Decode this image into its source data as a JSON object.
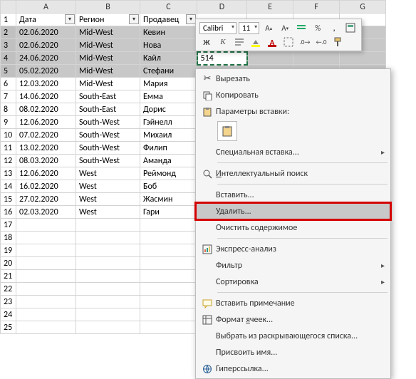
{
  "columns": [
    "A",
    "B",
    "C",
    "D",
    "E",
    "F",
    "G"
  ],
  "headers": {
    "A": "Дата",
    "B": "Регион",
    "C": "Продавец"
  },
  "rows": [
    {
      "n": 1,
      "header": true
    },
    {
      "n": 2,
      "sel": true,
      "A": "02.06.2020",
      "B": "Mid-West",
      "C": "Кевин"
    },
    {
      "n": 3,
      "sel": true,
      "A": "02.06.2020",
      "B": "Mid-West",
      "C": "Нова"
    },
    {
      "n": 4,
      "sel": true,
      "A": "24.06.2020",
      "B": "Mid-West",
      "C": "Кайл",
      "D": "514"
    },
    {
      "n": 5,
      "sel": true,
      "A": "05.02.2020",
      "B": "Mid-West",
      "C": "Стефани"
    },
    {
      "n": 6,
      "A": "12.03.2020",
      "B": "Mid-West",
      "C": "Мария"
    },
    {
      "n": 7,
      "A": "14.06.2020",
      "B": "South-East",
      "C": "Емма"
    },
    {
      "n": 8,
      "A": "08.02.2020",
      "B": "South-East",
      "C": "Дорис"
    },
    {
      "n": 9,
      "A": "12.06.2020",
      "B": "South-West",
      "C": "Гэйнелл"
    },
    {
      "n": 10,
      "A": "07.02.2020",
      "B": "South-West",
      "C": "Михаил"
    },
    {
      "n": 11,
      "A": "13.02.2020",
      "B": "South-West",
      "C": "Филип"
    },
    {
      "n": 12,
      "A": "08.03.2020",
      "B": "South-West",
      "C": "Аманда"
    },
    {
      "n": 13,
      "A": "12.06.2020",
      "B": "West",
      "C": "Реймонд"
    },
    {
      "n": 14,
      "A": "16.02.2020",
      "B": "West",
      "C": "Боб"
    },
    {
      "n": 15,
      "A": "27.02.2020",
      "B": "West",
      "C": "Жасмин"
    },
    {
      "n": 16,
      "A": "02.03.2020",
      "B": "West",
      "C": "Гари"
    },
    {
      "n": 17
    },
    {
      "n": 18
    },
    {
      "n": 19
    },
    {
      "n": 20
    },
    {
      "n": 21
    },
    {
      "n": 22
    },
    {
      "n": 23
    },
    {
      "n": 24
    },
    {
      "n": 25
    }
  ],
  "toolbar": {
    "font": "Calibri",
    "size": "11",
    "buttons_row1": [
      "A↑",
      "A↓",
      "s",
      "%",
      ",",
      "fmt"
    ],
    "bold": "Ж",
    "italic": "К"
  },
  "context_menu": {
    "cut": "Вырезать",
    "copy": "Копировать",
    "paste_heading": "Параметры вставки:",
    "paste_special": "Специальная вставка...",
    "smart_lookup": "Интеллектуальный поиск",
    "insert": "Вставить...",
    "delete": "Удалить...",
    "clear": "Очистить содержимое",
    "quick_analysis": "Экспресс-анализ",
    "filter": "Фильтр",
    "sort": "Сортировка",
    "insert_comment": "Вставить примечание",
    "format_cells": "Формат ячеек...",
    "pick_list": "Выбрать из раскрывающегося списка...",
    "define_name": "Присвоить имя...",
    "hyperlink": "Гиперссылка..."
  }
}
